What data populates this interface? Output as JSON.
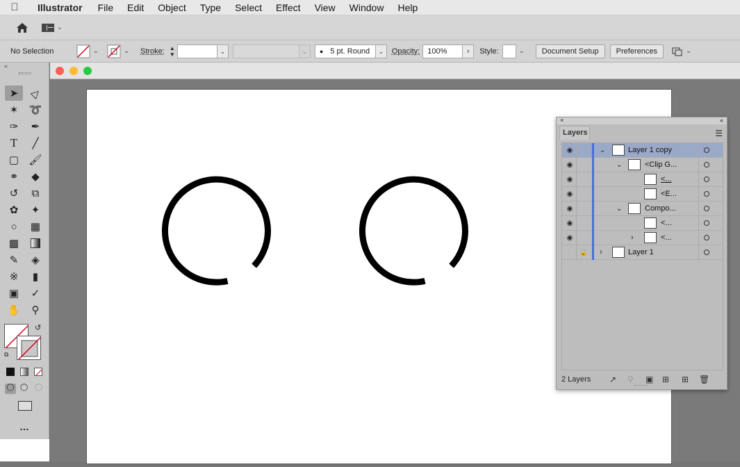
{
  "menubar": {
    "app": "Illustrator",
    "items": [
      "File",
      "Edit",
      "Object",
      "Type",
      "Select",
      "Effect",
      "View",
      "Window",
      "Help"
    ]
  },
  "control": {
    "selection": "No Selection",
    "stroke_label": "Stroke:",
    "brush": "5 pt. Round",
    "opacity_label": "Opacity:",
    "opacity": "100%",
    "style_label": "Style:",
    "doc_setup": "Document Setup",
    "preferences": "Preferences"
  },
  "layers": {
    "tab": "Layers",
    "footer": "2 Layers",
    "rows": [
      {
        "name": "Layer 1 copy"
      },
      {
        "name": "<Clip G..."
      },
      {
        "name": "<..."
      },
      {
        "name": "<E..."
      },
      {
        "name": "Compo..."
      },
      {
        "name": "<..."
      },
      {
        "name": "<..."
      },
      {
        "name": "Layer 1"
      }
    ]
  },
  "colors": {
    "accent": "#4a6fe0",
    "highlight": "#9aa9c7",
    "stroke_none": "#d0021b"
  }
}
